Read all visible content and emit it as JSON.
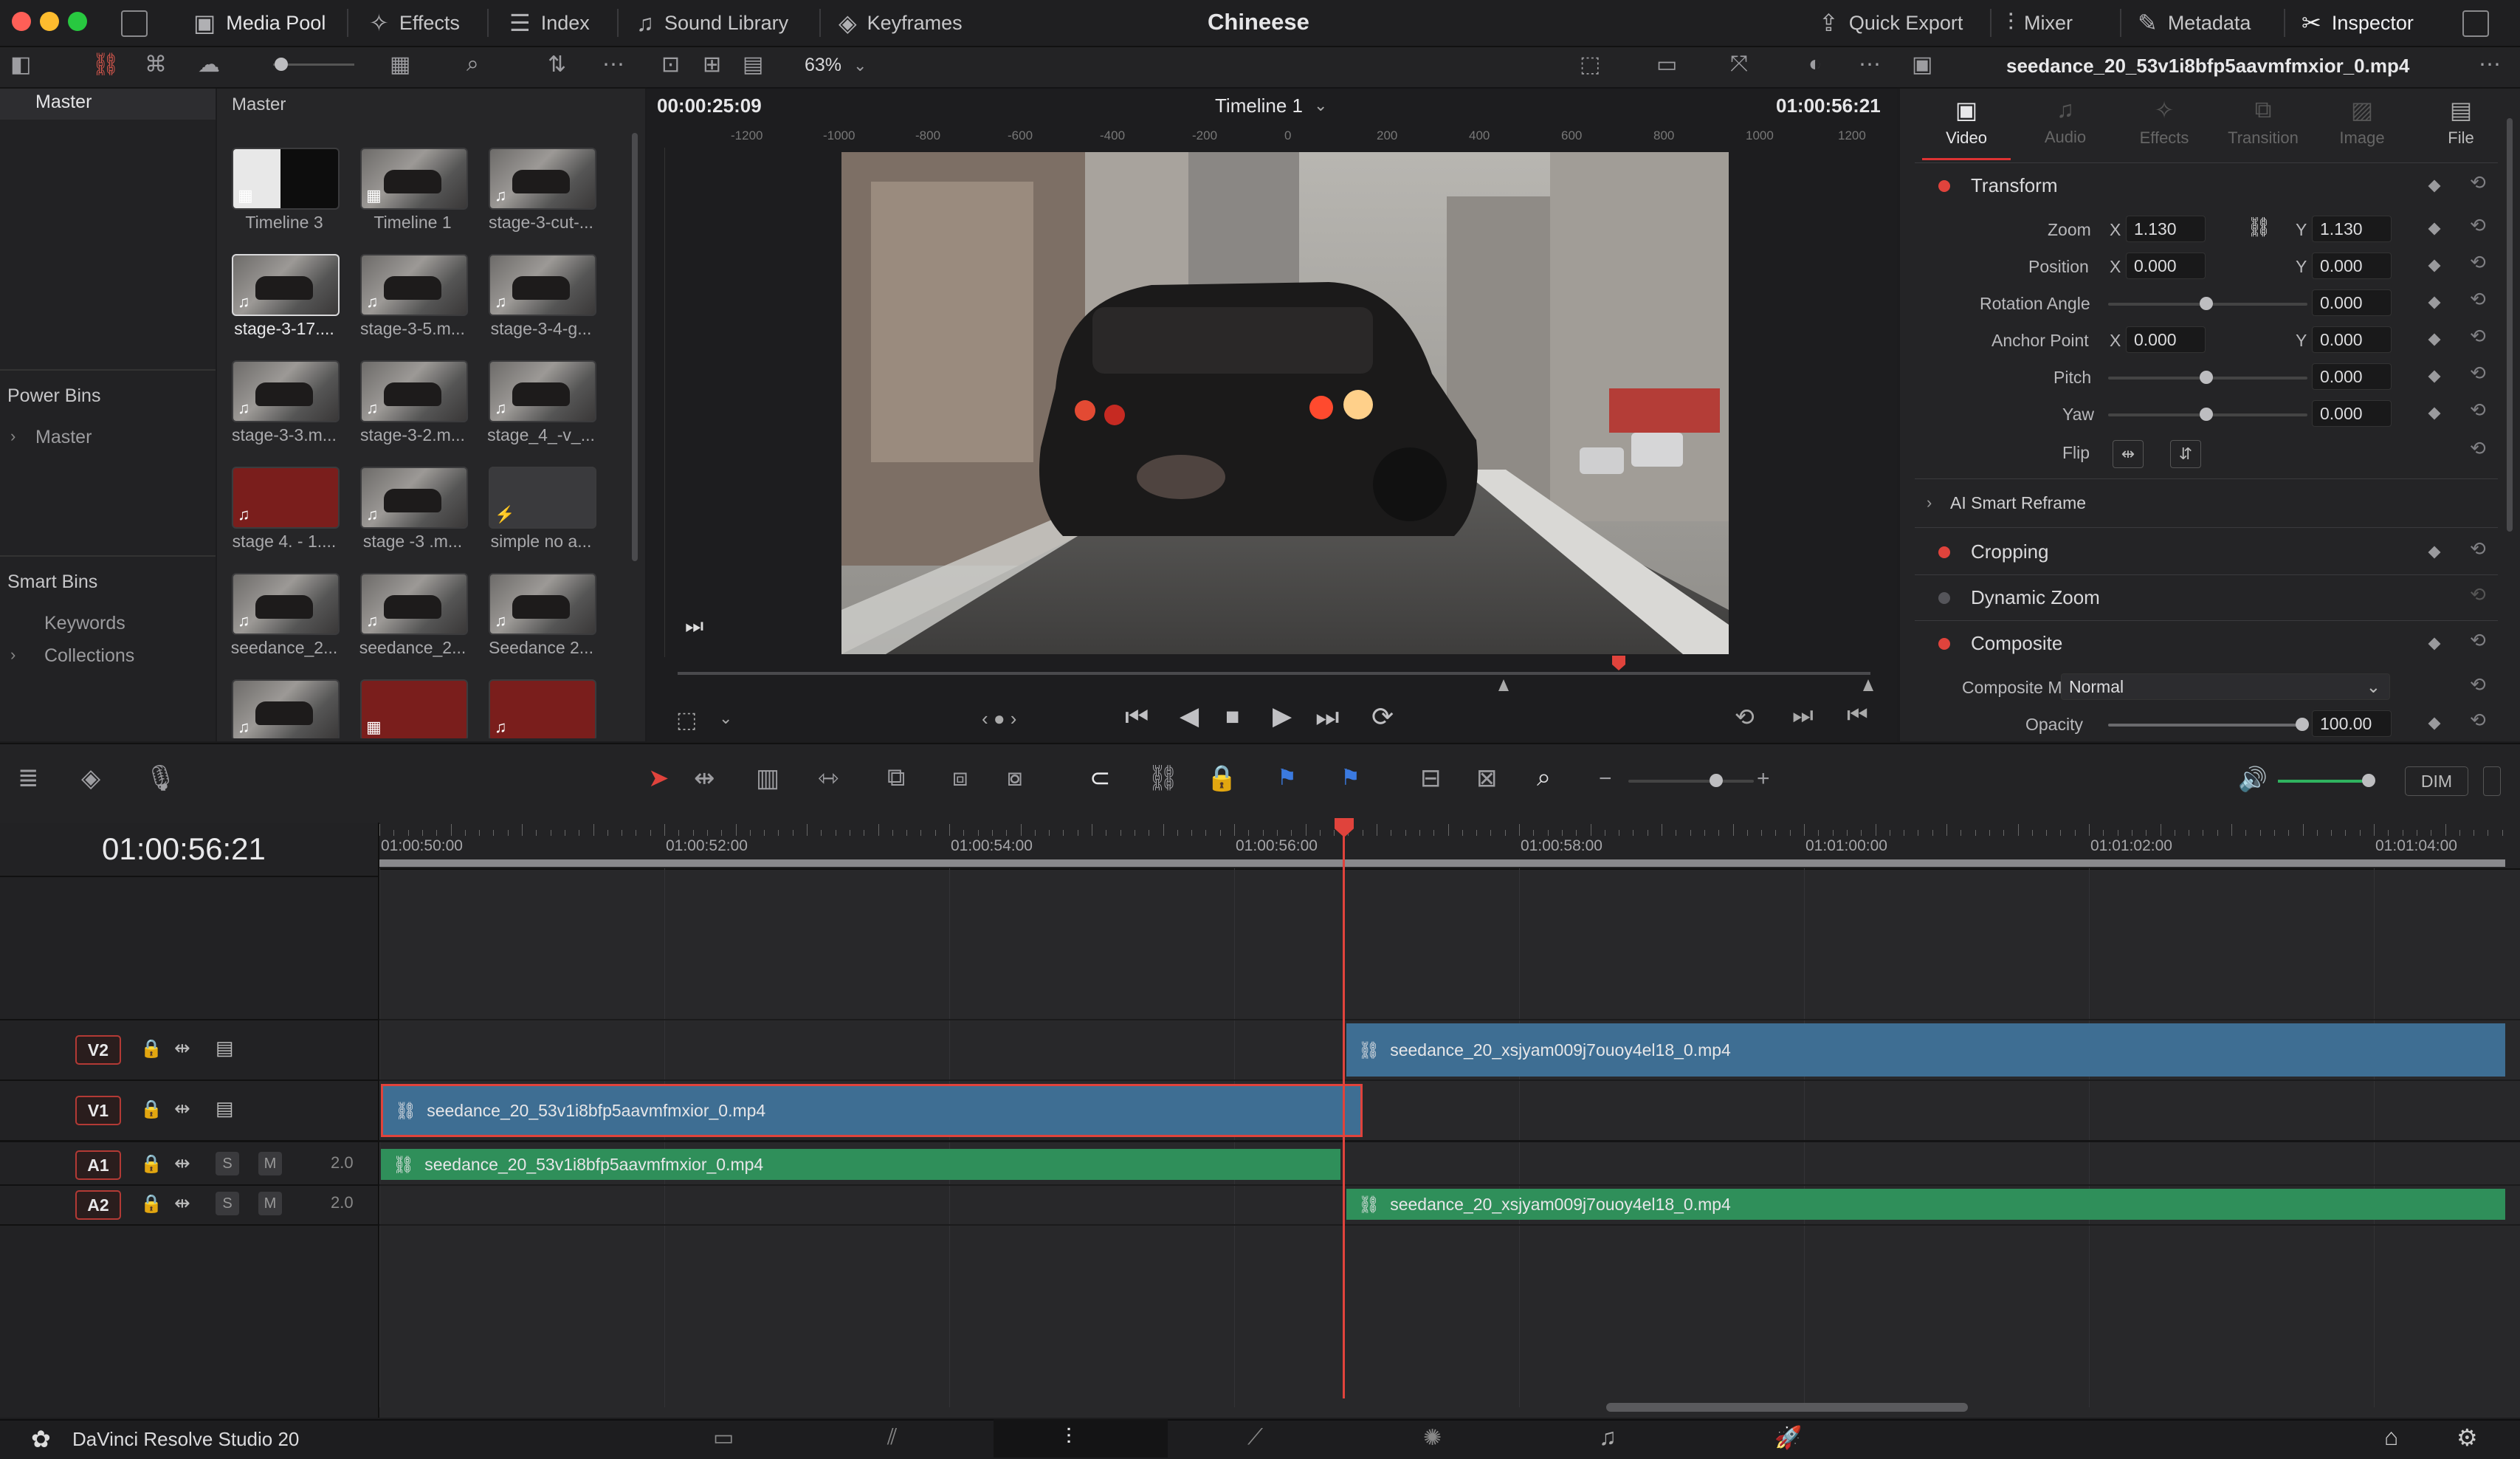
{
  "window": {
    "title": "Chineese"
  },
  "topbar": {
    "media_pool": "Media Pool",
    "effects": "Effects",
    "index": "Index",
    "sound_library": "Sound Library",
    "keyframes": "Keyframes",
    "quick_export": "Quick Export",
    "mixer": "Mixer",
    "metadata": "Metadata",
    "inspector": "Inspector"
  },
  "toolbar2": {
    "zoom": "63%",
    "inspector_clip": "seedance_20_53v1i8bfp5aavmfmxior_0.mp4"
  },
  "sidebar": {
    "master": "Master",
    "power_bins": "Power Bins",
    "power_master": "Master",
    "smart_bins": "Smart Bins",
    "keywords": "Keywords",
    "collections": "Collections"
  },
  "pool": {
    "header": "Master",
    "items": [
      {
        "label": "Timeline 3"
      },
      {
        "label": "Timeline 1"
      },
      {
        "label": "stage-3-cut-..."
      },
      {
        "label": "stage-3-17...."
      },
      {
        "label": "stage-3-5.m..."
      },
      {
        "label": "stage-3-4-g..."
      },
      {
        "label": "stage-3-3.m..."
      },
      {
        "label": "stage-3-2.m..."
      },
      {
        "label": "stage_4_-v_..."
      },
      {
        "label": "stage 4. - 1...."
      },
      {
        "label": "stage -3 .m..."
      },
      {
        "label": "simple no a..."
      },
      {
        "label": "seedance_2..."
      },
      {
        "label": "seedance_2..."
      },
      {
        "label": "Seedance 2..."
      },
      {
        "label": ""
      },
      {
        "label": ""
      },
      {
        "label": ""
      }
    ]
  },
  "viewer": {
    "timecode_left": "00:00:25:09",
    "timeline_name": "Timeline 1",
    "timecode_right": "01:00:56:21",
    "ruler": [
      "-1200",
      "-1000",
      "-800",
      "-600",
      "-400",
      "-200",
      "0",
      "200",
      "400",
      "600",
      "800",
      "1000",
      "1200"
    ]
  },
  "inspector": {
    "tabs": [
      "Video",
      "Audio",
      "Effects",
      "Transition",
      "Image",
      "File"
    ],
    "transform": "Transform",
    "zoom_label": "Zoom",
    "zoom_x": "1.130",
    "zoom_y": "1.130",
    "position_label": "Position",
    "position_x": "0.000",
    "position_y": "0.000",
    "rotation_label": "Rotation Angle",
    "rotation": "0.000",
    "anchor_label": "Anchor Point",
    "anchor_x": "0.000",
    "anchor_y": "0.000",
    "pitch_label": "Pitch",
    "pitch": "0.000",
    "yaw_label": "Yaw",
    "yaw": "0.000",
    "flip_label": "Flip",
    "smart_reframe": "AI Smart Reframe",
    "cropping": "Cropping",
    "dynamic_zoom": "Dynamic Zoom",
    "composite": "Composite",
    "composite_mode_label": "Composite Mode",
    "composite_mode": "Normal",
    "opacity_label": "Opacity",
    "opacity": "100.00",
    "x": "X",
    "y": "Y"
  },
  "timeline": {
    "timecode": "01:00:56:21",
    "dim": "DIM",
    "ruler": [
      "01:00:50:00",
      "01:00:52:00",
      "01:00:54:00",
      "01:00:56:00",
      "01:00:58:00",
      "01:01:00:00",
      "01:01:02:00",
      "01:01:04:00"
    ],
    "tracks": {
      "v2": "V2",
      "v1": "V1",
      "a1": "A1",
      "a2": "A2",
      "s": "S",
      "m": "M",
      "a1_level": "2.0",
      "a2_level": "2.0"
    },
    "clips": {
      "v2": "seedance_20_xsjyam009j7ouoy4el18_0.mp4",
      "v1": "seedance_20_53v1i8bfp5aavmfmxior_0.mp4",
      "a1": "seedance_20_53v1i8bfp5aavmfmxior_0.mp4",
      "a2": "seedance_20_xsjyam009j7ouoy4el18_0.mp4"
    }
  },
  "bottom": {
    "app": "DaVinci Resolve Studio 20"
  },
  "colors": {
    "accent_red": "#e0433c",
    "video_clip": "#3e6e93",
    "audio_clip": "#2f8f5a"
  }
}
